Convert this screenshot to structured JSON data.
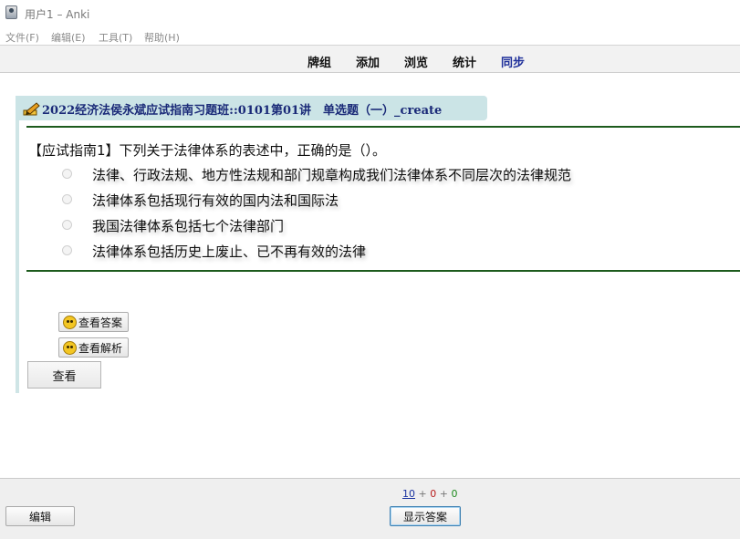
{
  "window": {
    "title": "用户1 – Anki"
  },
  "menu": [
    "文件(F)",
    "编辑(E)",
    "工具(T)",
    "帮助(H)"
  ],
  "toolbar": {
    "decks": "牌组",
    "add": "添加",
    "browse": "浏览",
    "stats": "统计",
    "sync": "同步"
  },
  "card": {
    "deck_title": "2022经济法侯永斌应试指南习题班::0101第01讲　单选题（一）_create",
    "question": "【应试指南1】下列关于法律体系的表述中，正确的是（）。",
    "options": [
      "法律、行政法规、地方性法规和部门规章构成我们法律体系不同层次的法律规范",
      "法律体系包括现行有效的国内法和国际法",
      "我国法律体系包括七个法律部门",
      "法律体系包括历史上废止、已不再有效的法律"
    ],
    "view_answer_label": "查看答案",
    "view_analysis_label": "查看解析",
    "view_label": "查看"
  },
  "bottom": {
    "counts": {
      "new": "10",
      "learn": "0",
      "review": "0",
      "separator": "+"
    },
    "edit_label": "编辑",
    "show_answer_label": "显示答案"
  },
  "colors": {
    "sync": "#1e2f9a",
    "new": "#1a33a0",
    "learn": "#b81c1c",
    "review": "#1d8a1d",
    "header_bg": "#cbe4e6"
  }
}
